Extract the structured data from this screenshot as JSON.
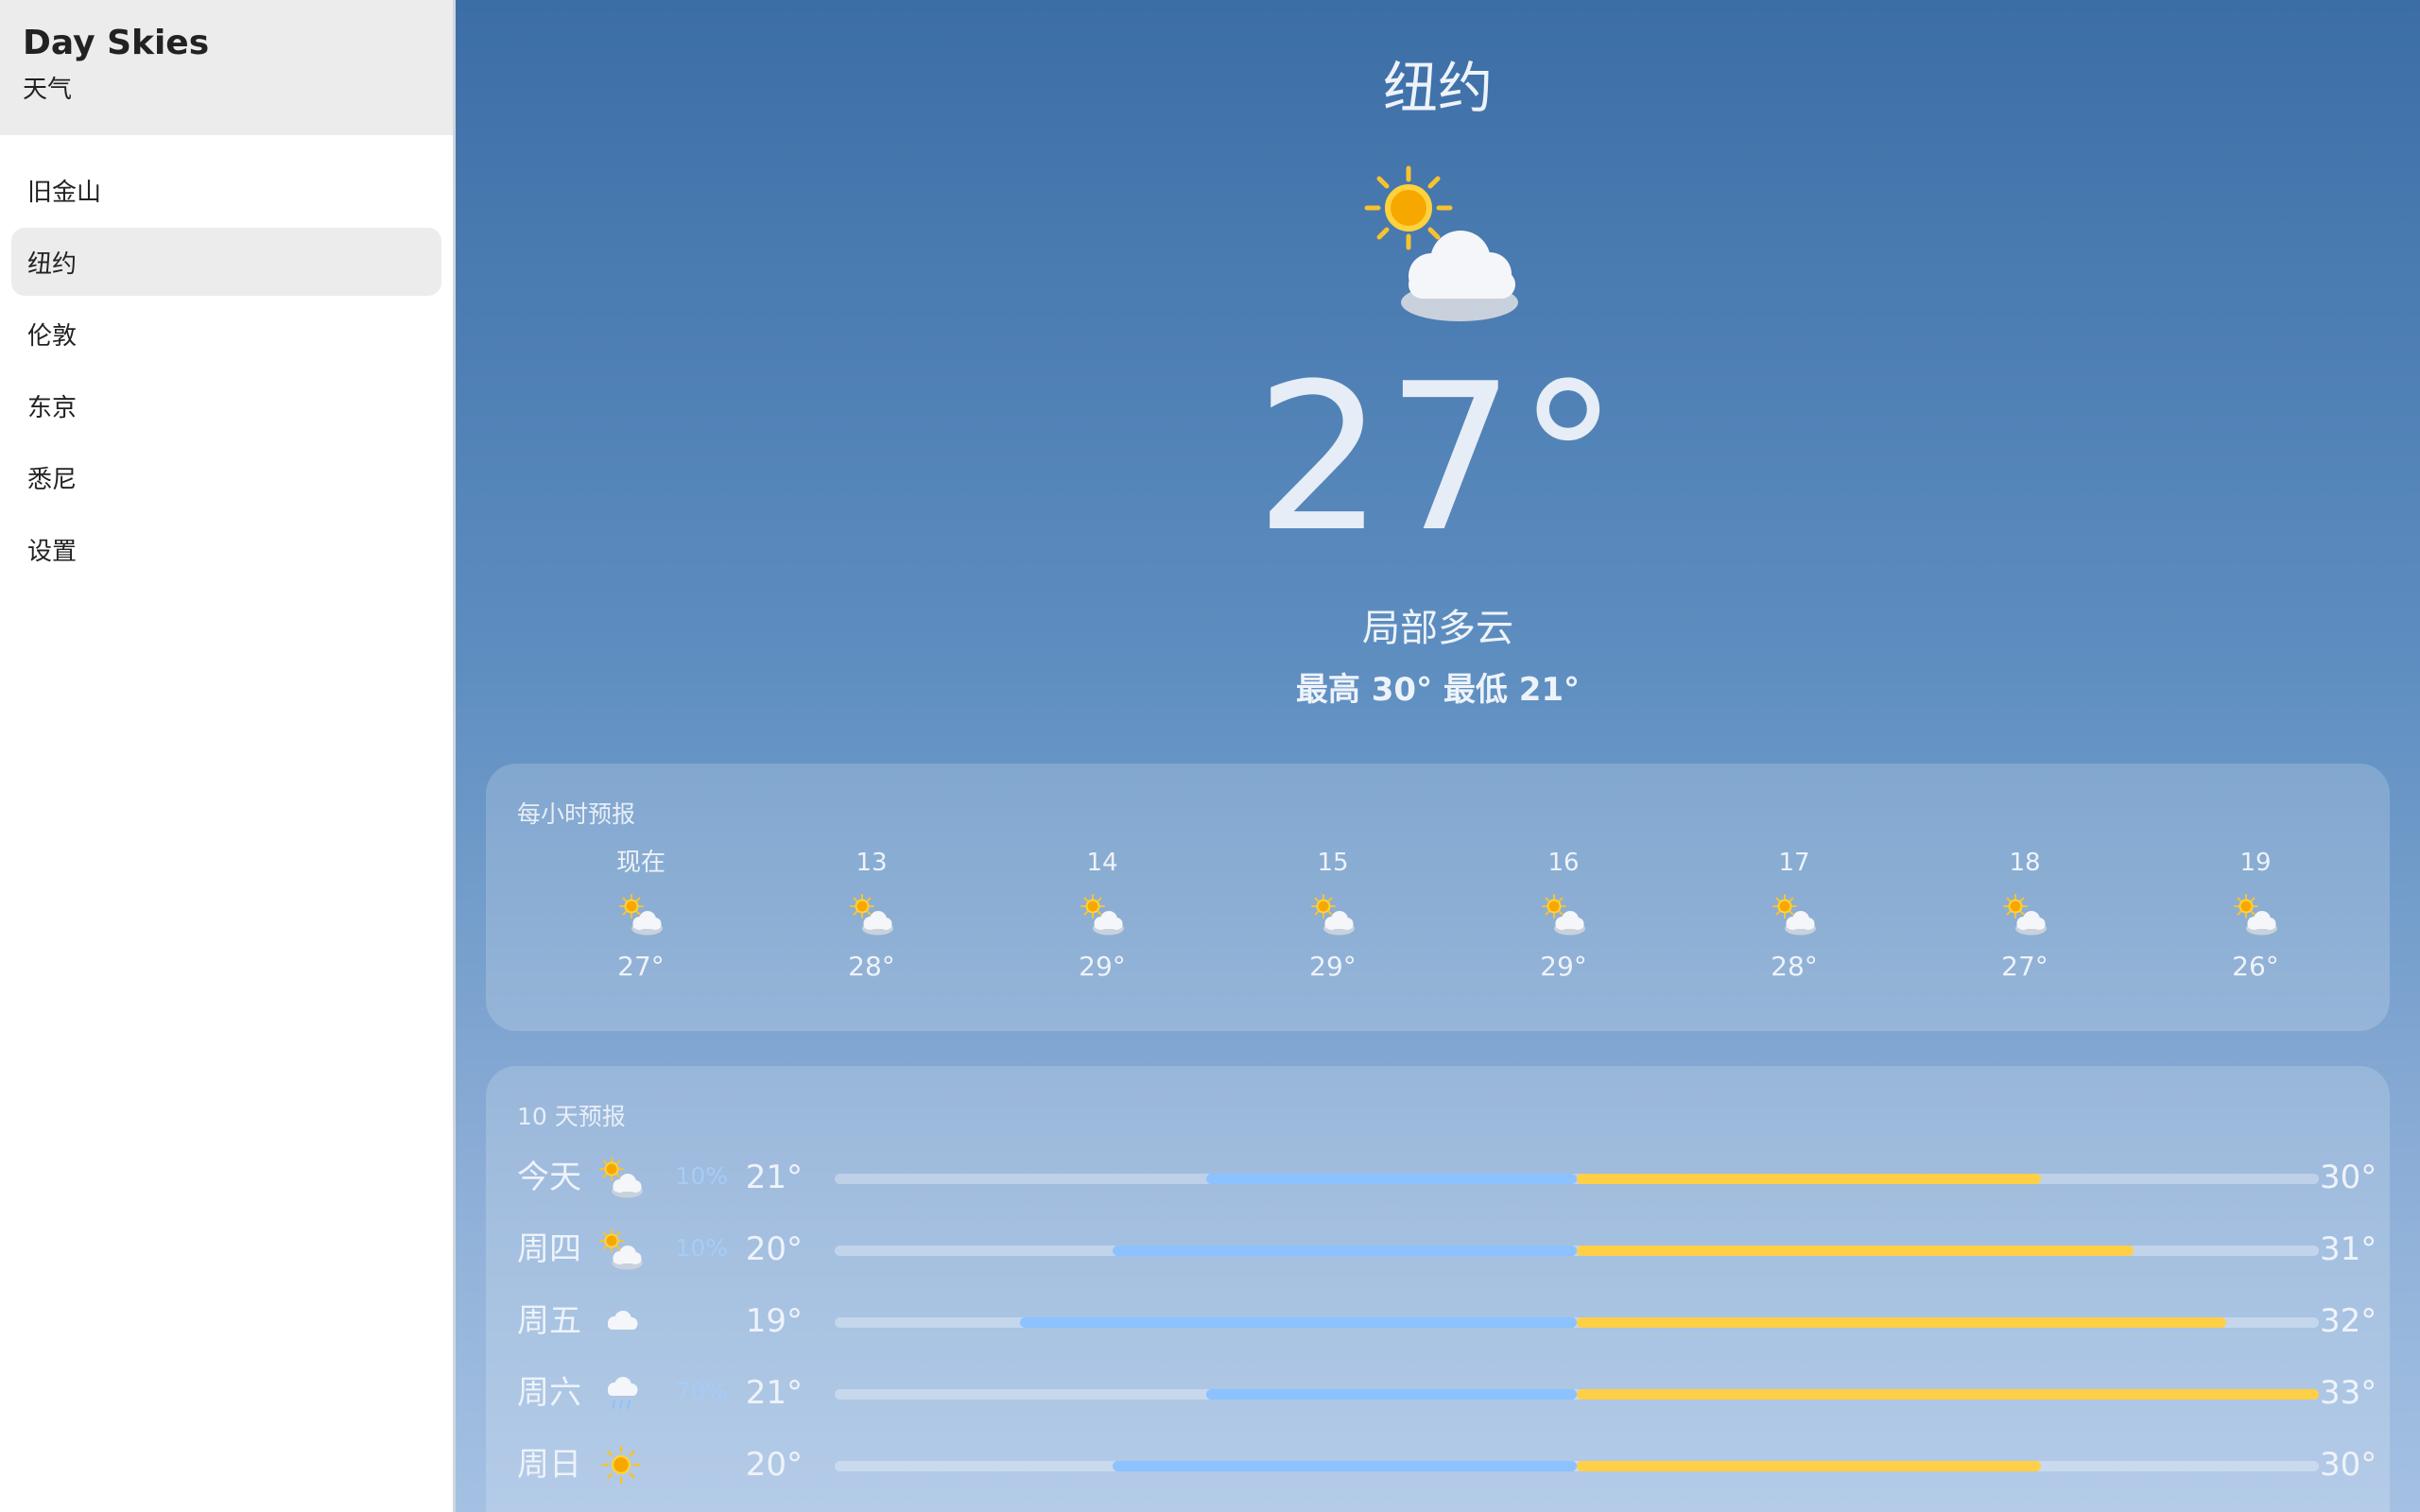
{
  "app": {
    "title": "Day Skies",
    "subtitle": "天气"
  },
  "sidebar": {
    "items": [
      {
        "label": "旧金山",
        "active": false
      },
      {
        "label": "纽约",
        "active": true
      },
      {
        "label": "伦敦",
        "active": false
      },
      {
        "label": "东京",
        "active": false
      },
      {
        "label": "悉尼",
        "active": false
      },
      {
        "label": "设置",
        "active": false
      }
    ]
  },
  "current": {
    "city": "纽约",
    "icon": "partly-cloudy-icon",
    "temperature": "27°",
    "condition": "局部多云",
    "high_low": "最高 30° 最低 21°"
  },
  "hourly": {
    "title": "每小时预报",
    "hours": [
      {
        "label": "现在",
        "icon": "partly-cloudy-icon",
        "temp": "27°"
      },
      {
        "label": "13",
        "icon": "partly-cloudy-icon",
        "temp": "28°"
      },
      {
        "label": "14",
        "icon": "partly-cloudy-icon",
        "temp": "29°"
      },
      {
        "label": "15",
        "icon": "partly-cloudy-icon",
        "temp": "29°"
      },
      {
        "label": "16",
        "icon": "partly-cloudy-icon",
        "temp": "29°"
      },
      {
        "label": "17",
        "icon": "partly-cloudy-icon",
        "temp": "28°"
      },
      {
        "label": "18",
        "icon": "partly-cloudy-icon",
        "temp": "27°"
      },
      {
        "label": "19",
        "icon": "partly-cloudy-icon",
        "temp": "26°"
      }
    ]
  },
  "daily": {
    "title": "10 天预报",
    "range_min": 17,
    "range_max": 33,
    "days": [
      {
        "name": "今天",
        "icon": "partly-cloudy-icon",
        "pop": "10%",
        "low": "21°",
        "high": "30°",
        "low_val": 21,
        "high_val": 30
      },
      {
        "name": "周四",
        "icon": "partly-cloudy-icon",
        "pop": "10%",
        "low": "20°",
        "high": "31°",
        "low_val": 20,
        "high_val": 31
      },
      {
        "name": "周五",
        "icon": "cloud-icon",
        "pop": "",
        "low": "19°",
        "high": "32°",
        "low_val": 19,
        "high_val": 32
      },
      {
        "name": "周六",
        "icon": "rain-icon",
        "pop": "70%",
        "low": "21°",
        "high": "33°",
        "low_val": 21,
        "high_val": 33
      },
      {
        "name": "周日",
        "icon": "sun-icon",
        "pop": "",
        "low": "20°",
        "high": "30°",
        "low_val": 20,
        "high_val": 30
      }
    ]
  },
  "colors": {
    "cool_bar": "#8bc2ff",
    "warm_bar": "#ffcf45",
    "sun": "#f8b400",
    "cloud": "#f4f6fa"
  }
}
